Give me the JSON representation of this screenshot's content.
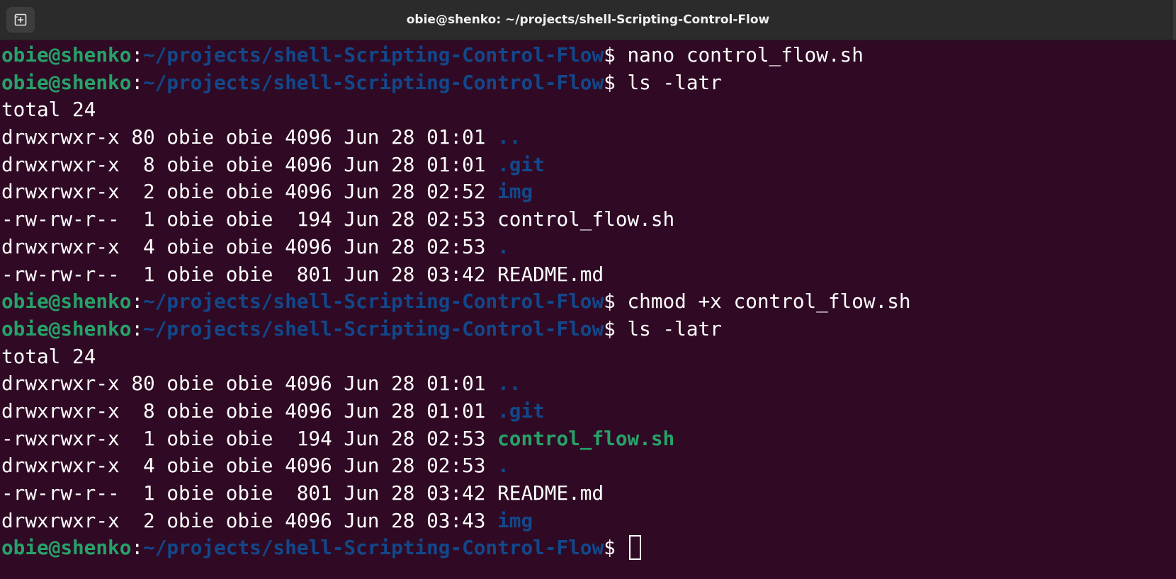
{
  "window": {
    "title": "obie@shenko: ~/projects/shell-Scripting-Control-Flow",
    "new_tab_icon": "new-tab-icon"
  },
  "colors": {
    "background": "#300a24",
    "prompt_user": "#26a269",
    "prompt_path": "#12488b",
    "directory": "#12488b",
    "executable": "#26a269",
    "text": "#ffffff"
  },
  "prompt": {
    "user": "obie@shenko",
    "separator": ":",
    "path": "~/projects/shell-Scripting-Control-Flow",
    "symbol": "$"
  },
  "session": [
    {
      "type": "prompt",
      "command": " nano control_flow.sh"
    },
    {
      "type": "prompt",
      "command": " ls -latr"
    },
    {
      "type": "output",
      "text": "total 24"
    },
    {
      "type": "entry",
      "info": "drwxrwxr-x 80 obie obie 4096 Jun 28 01:01 ",
      "name": "..",
      "kind": "dir"
    },
    {
      "type": "entry",
      "info": "drwxrwxr-x  8 obie obie 4096 Jun 28 01:01 ",
      "name": ".git",
      "kind": "dir"
    },
    {
      "type": "entry",
      "info": "drwxrwxr-x  2 obie obie 4096 Jun 28 02:52 ",
      "name": "img",
      "kind": "dir"
    },
    {
      "type": "entry",
      "info": "-rw-rw-r--  1 obie obie  194 Jun 28 02:53 ",
      "name": "control_flow.sh",
      "kind": "file"
    },
    {
      "type": "entry",
      "info": "drwxrwxr-x  4 obie obie 4096 Jun 28 02:53 ",
      "name": ".",
      "kind": "dir"
    },
    {
      "type": "entry",
      "info": "-rw-rw-r--  1 obie obie  801 Jun 28 03:42 ",
      "name": "README.md",
      "kind": "file"
    },
    {
      "type": "prompt",
      "command": " chmod +x control_flow.sh"
    },
    {
      "type": "prompt",
      "command": " ls -latr"
    },
    {
      "type": "output",
      "text": "total 24"
    },
    {
      "type": "entry",
      "info": "drwxrwxr-x 80 obie obie 4096 Jun 28 01:01 ",
      "name": "..",
      "kind": "dir"
    },
    {
      "type": "entry",
      "info": "drwxrwxr-x  8 obie obie 4096 Jun 28 01:01 ",
      "name": ".git",
      "kind": "dir"
    },
    {
      "type": "entry",
      "info": "-rwxrwxr-x  1 obie obie  194 Jun 28 02:53 ",
      "name": "control_flow.sh",
      "kind": "exec"
    },
    {
      "type": "entry",
      "info": "drwxrwxr-x  4 obie obie 4096 Jun 28 02:53 ",
      "name": ".",
      "kind": "dir"
    },
    {
      "type": "entry",
      "info": "-rw-rw-r--  1 obie obie  801 Jun 28 03:42 ",
      "name": "README.md",
      "kind": "file"
    },
    {
      "type": "entry",
      "info": "drwxrwxr-x  2 obie obie 4096 Jun 28 03:43 ",
      "name": "img",
      "kind": "dir"
    },
    {
      "type": "cursor",
      "command": " "
    }
  ]
}
